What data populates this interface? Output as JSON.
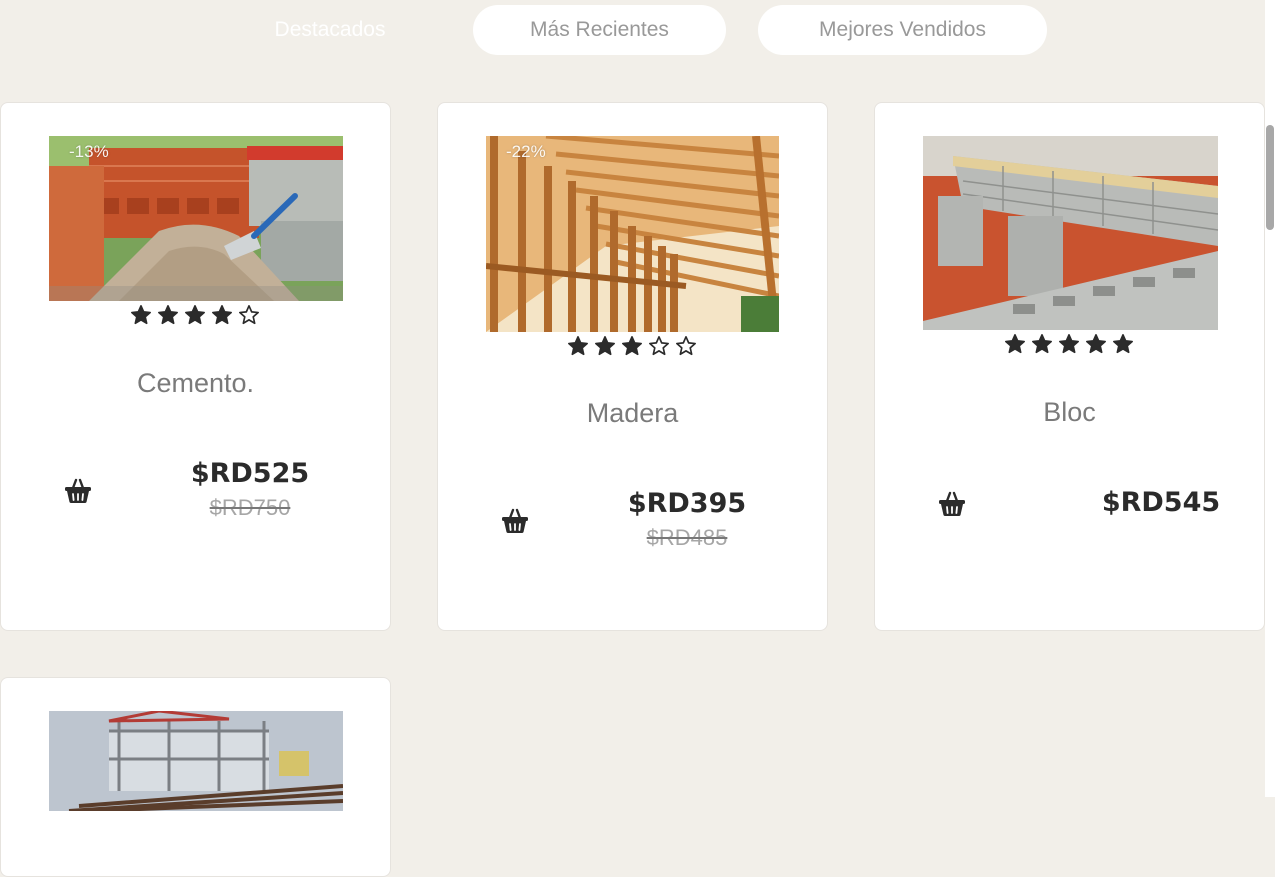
{
  "tabs": [
    {
      "label": "Destacados",
      "active": true
    },
    {
      "label": "Más Recientes",
      "active": false
    },
    {
      "label": "Mejores Vendidos",
      "active": false
    }
  ],
  "products": [
    {
      "name": "Cemento.",
      "discount": "-13%",
      "rating": 4,
      "max_rating": 5,
      "price": "$RD525",
      "old_price": "$RD750",
      "image_icon": "cement-bricks-photo"
    },
    {
      "name": "Madera",
      "discount": "-22%",
      "rating": 3,
      "max_rating": 5,
      "price": "$RD395",
      "old_price": "$RD485",
      "image_icon": "wood-frame-photo"
    },
    {
      "name": "Bloc",
      "discount": "",
      "rating": 5,
      "max_rating": 5,
      "price": "$RD545",
      "old_price": "",
      "image_icon": "concrete-block-photo"
    },
    {
      "name": "",
      "discount": "",
      "rating": null,
      "price": "",
      "old_price": "",
      "image_icon": "building-rebar-photo"
    }
  ],
  "icons": {
    "cart": "shopping-basket-icon",
    "star_filled": "star-filled-icon",
    "star_empty": "star-outline-icon"
  },
  "colors": {
    "background": "#f2efe9",
    "card": "#ffffff",
    "text_dark": "#2b2b2b",
    "text_muted": "#7a7a7a"
  }
}
